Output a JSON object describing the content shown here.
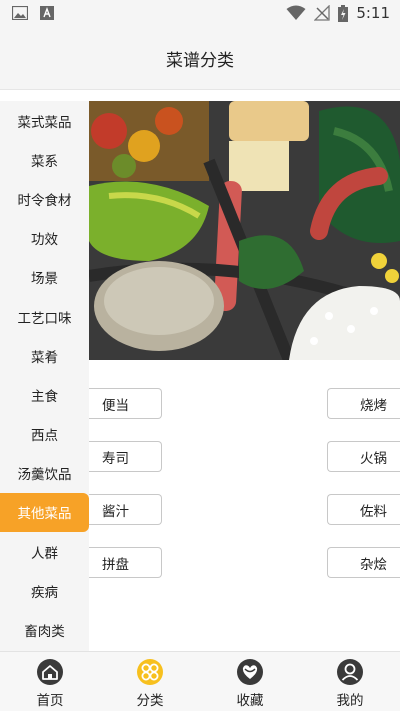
{
  "status_bar": {
    "time": "5:11"
  },
  "header": {
    "title": "菜谱分类"
  },
  "sidebar": {
    "items": [
      {
        "label": "菜式菜品"
      },
      {
        "label": "菜系"
      },
      {
        "label": "时令食材"
      },
      {
        "label": "功效"
      },
      {
        "label": "场景"
      },
      {
        "label": "工艺口味"
      },
      {
        "label": "菜肴"
      },
      {
        "label": "主食"
      },
      {
        "label": "西点"
      },
      {
        "label": "汤羹饮品"
      },
      {
        "label": "其他菜品",
        "active": true
      },
      {
        "label": "人群"
      },
      {
        "label": "疾病"
      },
      {
        "label": "畜肉类"
      }
    ]
  },
  "tags": {
    "left": [
      "便当",
      "寿司",
      "酱汁",
      "拼盘"
    ],
    "right": [
      "烧烤",
      "火锅",
      "佐料",
      "杂烩"
    ]
  },
  "bottom_nav": {
    "items": [
      {
        "label": "首页",
        "icon": "home-icon"
      },
      {
        "label": "分类",
        "icon": "category-icon",
        "active": true
      },
      {
        "label": "收藏",
        "icon": "favorites-icon"
      },
      {
        "label": "我的",
        "icon": "profile-icon"
      }
    ]
  },
  "colors": {
    "accent": "#f7a227",
    "nav_icon": "#3a3a3a"
  }
}
